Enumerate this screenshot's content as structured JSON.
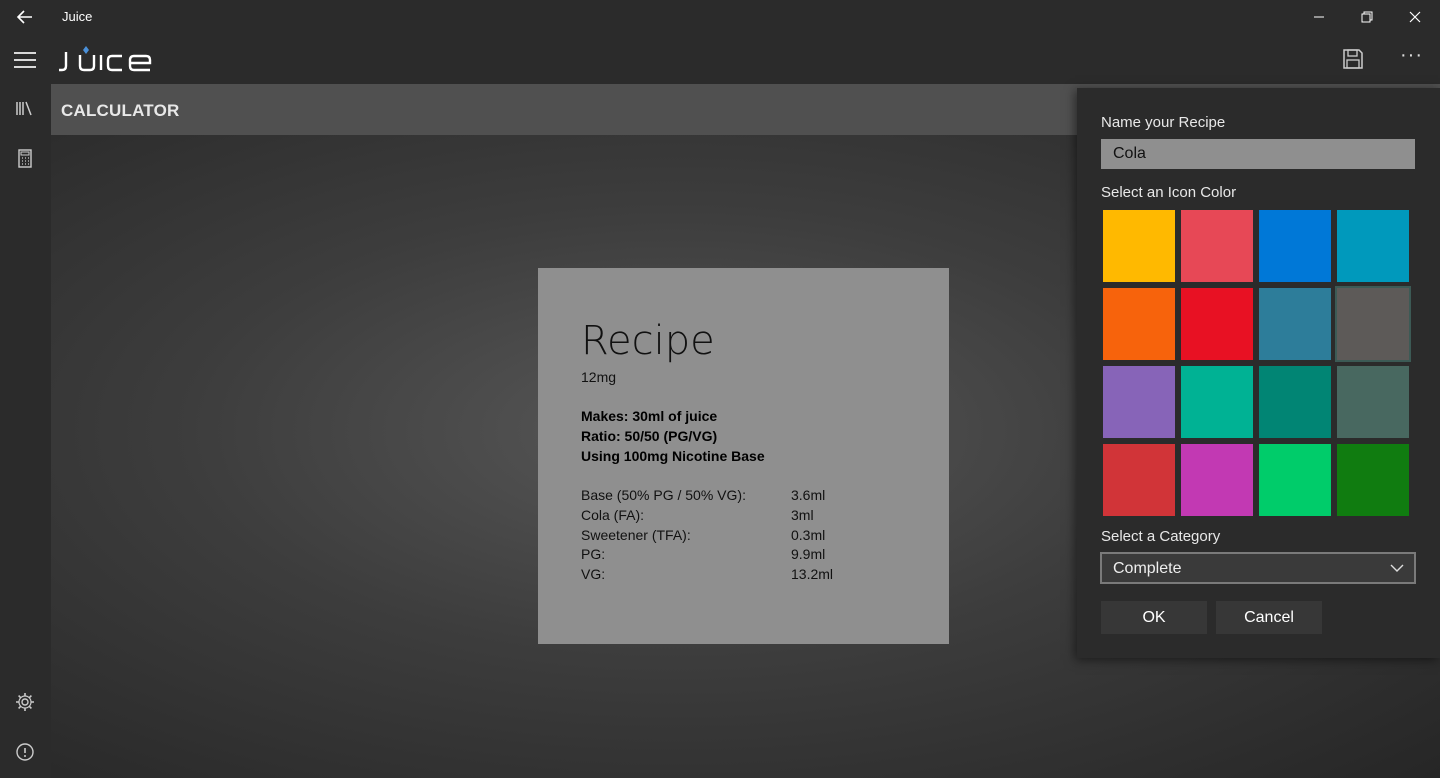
{
  "window": {
    "title": "Juice"
  },
  "app": {
    "logo_text": "JUICE"
  },
  "page": {
    "title": "CALCULATOR"
  },
  "recipe_card": {
    "title": "Recipe",
    "strength": "12mg",
    "makes": "Makes: 30ml of juice",
    "ratio": "Ratio: 50/50 (PG/VG)",
    "base": "Using 100mg Nicotine Base",
    "ingredients": [
      {
        "name": "Base (50% PG / 50% VG):",
        "amount": "3.6ml"
      },
      {
        "name": "Cola (FA):",
        "amount": "3ml"
      },
      {
        "name": "Sweetener (TFA):",
        "amount": "0.3ml"
      },
      {
        "name": "PG:",
        "amount": "9.9ml"
      },
      {
        "name": "VG:",
        "amount": "13.2ml"
      }
    ]
  },
  "dialog": {
    "name_label": "Name your Recipe",
    "name_value": "Cola",
    "color_label": "Select an Icon Color",
    "colors": [
      "#ffb900",
      "#e74856",
      "#0078d7",
      "#0099bc",
      "#f7630c",
      "#e81123",
      "#2d7d9a",
      "#5d5a58",
      "#8764b8",
      "#00b294",
      "#018574",
      "#486860",
      "#d13438",
      "#c239b3",
      "#00cc6a",
      "#107c10"
    ],
    "selected_color": "#5d5a58",
    "category_label": "Select a Category",
    "category_value": "Complete",
    "ok_label": "OK",
    "cancel_label": "Cancel"
  }
}
